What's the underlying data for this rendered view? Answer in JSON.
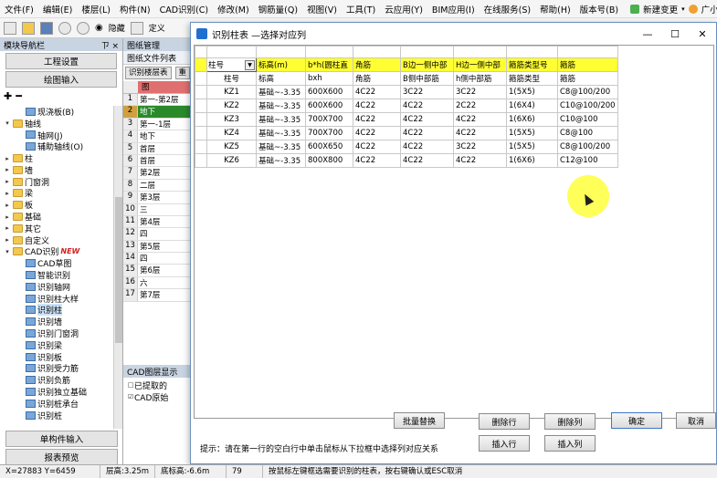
{
  "menubar": {
    "items": [
      "文件(F)",
      "编辑(E)",
      "楼层(L)",
      "构件(N)",
      "CAD识别(C)",
      "修改(M)",
      "钢筋量(Q)",
      "视图(V)",
      "工具(T)",
      "云应用(Y)",
      "BIM应用(I)",
      "在线服务(S)",
      "帮助(H)",
      "版本号(B)"
    ],
    "new_change": "新建变更",
    "user": "广小二"
  },
  "toolbar": {
    "hide": "隐藏",
    "define": "定义"
  },
  "leftnav": {
    "title": "模块导航栏",
    "pin": "ㄗ",
    "close": "×",
    "project_settings": "工程设置",
    "drawing_input": "绘图输入",
    "tree": [
      {
        "label": "现浇板(B)",
        "indent": 2,
        "type": "tool"
      },
      {
        "label": "轴线",
        "indent": 0,
        "type": "folder",
        "exp": "▾"
      },
      {
        "label": "轴网(J)",
        "indent": 2,
        "type": "tool"
      },
      {
        "label": "辅助轴线(O)",
        "indent": 2,
        "type": "tool"
      },
      {
        "label": "柱",
        "indent": 0,
        "type": "folder",
        "exp": "▸"
      },
      {
        "label": "墙",
        "indent": 0,
        "type": "folder",
        "exp": "▸"
      },
      {
        "label": "门窗洞",
        "indent": 0,
        "type": "folder",
        "exp": "▸"
      },
      {
        "label": "梁",
        "indent": 0,
        "type": "folder",
        "exp": "▸"
      },
      {
        "label": "板",
        "indent": 0,
        "type": "folder",
        "exp": "▸"
      },
      {
        "label": "基础",
        "indent": 0,
        "type": "folder",
        "exp": "▸"
      },
      {
        "label": "其它",
        "indent": 0,
        "type": "folder",
        "exp": "▸"
      },
      {
        "label": "自定义",
        "indent": 0,
        "type": "folder",
        "exp": "▸"
      },
      {
        "label": "CAD识别",
        "indent": 0,
        "type": "folder",
        "exp": "▾",
        "badge": "NEW"
      },
      {
        "label": "CAD草图",
        "indent": 2,
        "type": "tool"
      },
      {
        "label": "智能识别",
        "indent": 2,
        "type": "tool"
      },
      {
        "label": "识别轴网",
        "indent": 2,
        "type": "tool"
      },
      {
        "label": "识别柱大样",
        "indent": 2,
        "type": "tool"
      },
      {
        "label": "识别柱",
        "indent": 2,
        "type": "tool",
        "selected": true
      },
      {
        "label": "识别墙",
        "indent": 2,
        "type": "tool"
      },
      {
        "label": "识别门窗洞",
        "indent": 2,
        "type": "tool"
      },
      {
        "label": "识别梁",
        "indent": 2,
        "type": "tool"
      },
      {
        "label": "识别板",
        "indent": 2,
        "type": "tool"
      },
      {
        "label": "识别受力筋",
        "indent": 2,
        "type": "tool"
      },
      {
        "label": "识别负筋",
        "indent": 2,
        "type": "tool"
      },
      {
        "label": "识别独立基础",
        "indent": 2,
        "type": "tool"
      },
      {
        "label": "识别桩承台",
        "indent": 2,
        "type": "tool"
      },
      {
        "label": "识别桩",
        "indent": 2,
        "type": "tool"
      }
    ],
    "single_component_input": "单构件输入",
    "report_preview": "报表预览"
  },
  "midpanel": {
    "title": "图纸管理",
    "tab": "图纸文件列表",
    "btn1": "识别楼层表",
    "btn2": "重",
    "header": "图",
    "rows": [
      {
        "n": "1",
        "t": "第一-第2层"
      },
      {
        "n": "2",
        "t": "地下",
        "hl": true
      },
      {
        "n": "3",
        "t": "第一-1层"
      },
      {
        "n": "4",
        "t": "地下"
      },
      {
        "n": "5",
        "t": "首层"
      },
      {
        "n": "6",
        "t": "首层"
      },
      {
        "n": "7",
        "t": "第2层"
      },
      {
        "n": "8",
        "t": "二层"
      },
      {
        "n": "9",
        "t": "第3层"
      },
      {
        "n": "10",
        "t": "三"
      },
      {
        "n": "11",
        "t": "第4层"
      },
      {
        "n": "12",
        "t": "四"
      },
      {
        "n": "13",
        "t": "第5层"
      },
      {
        "n": "14",
        "t": "四"
      },
      {
        "n": "15",
        "t": "第6层"
      },
      {
        "n": "16",
        "t": "六"
      },
      {
        "n": "17",
        "t": "第7层"
      }
    ],
    "cad_layers": "CAD图层显示",
    "layer1": "已提取的",
    "layer2": "CAD原始"
  },
  "dialog": {
    "title": "识别柱表 —选择对应列",
    "window_min": "—",
    "window_max": "☐",
    "window_close": "✕",
    "mapping_row": [
      "柱号",
      "标高(m)",
      "b*h(圆柱直",
      "角筋",
      "B边一侧中部",
      "H边一侧中部",
      "箍筋类型号",
      "箍筋"
    ],
    "header_row": [
      "柱号",
      "标高",
      "bxh",
      "角筋",
      "B侧中部筋",
      "h侧中部筋",
      "箍筋类型",
      "箍筋"
    ],
    "rows": [
      [
        "KZ1",
        "基础~-3.35",
        "600X600",
        "4C22",
        "3C22",
        "3C22",
        "1(5X5)",
        "C8@100/200"
      ],
      [
        "KZ2",
        "基础~-3.35",
        "600X600",
        "4C22",
        "4C22",
        "2C22",
        "1(6X4)",
        "C10@100/200"
      ],
      [
        "KZ3",
        "基础~-3.35",
        "700X700",
        "4C22",
        "4C22",
        "4C22",
        "1(6X6)",
        "C10@100"
      ],
      [
        "KZ4",
        "基础~-3.35",
        "700X700",
        "4C22",
        "4C22",
        "4C22",
        "1(5X5)",
        "C8@100"
      ],
      [
        "KZ5",
        "基础~-3.35",
        "600X650",
        "4C22",
        "4C22",
        "3C22",
        "1(5X5)",
        "C8@100/200"
      ],
      [
        "KZ6",
        "基础~-3.35",
        "800X800",
        "4C22",
        "4C22",
        "4C22",
        "1(6X6)",
        "C12@100"
      ]
    ],
    "btn_batch_replace": "批量替换",
    "btn_delete_row": "删除行",
    "btn_delete_col": "删除列",
    "btn_insert_row": "插入行",
    "btn_insert_col": "插入列",
    "btn_ok": "确定",
    "btn_cancel": "取消",
    "hint": "提示：请在第一行的空白行中单击鼠标从下拉框中选择列对应关系"
  },
  "statusbar": {
    "x": "X=27883 Y=6459",
    "floor_height": "层高:3.25m",
    "bottom_elev": "底标高:-6.6m",
    "num": "79",
    "tip": "按鼠标左键框选需要识别的柱表，按右键确认或ESC取消"
  }
}
